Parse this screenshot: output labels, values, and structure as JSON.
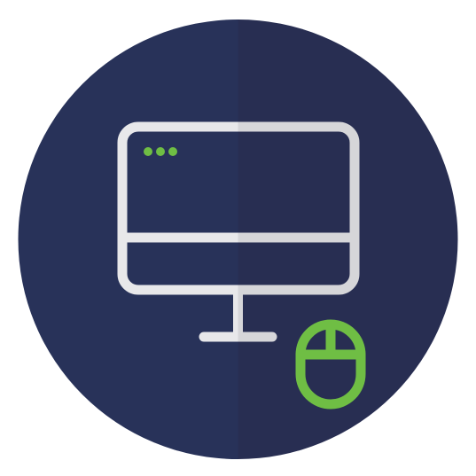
{
  "icon": {
    "subject": "computer-monitor-with-mouse",
    "colors": {
      "background": "#ffffff",
      "circle_left": "#283259",
      "circle_right": "#282e52",
      "monitor_stroke_left": "#e8e8ea",
      "monitor_stroke_right": "#d6d6d9",
      "window_dots": "#6fbe44",
      "mouse_stroke": "#6fbe44"
    },
    "window_dot_count": 3
  }
}
